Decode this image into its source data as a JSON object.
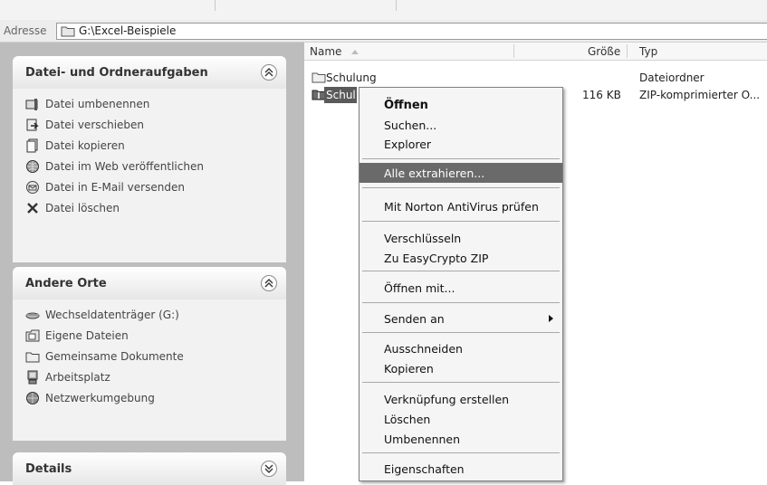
{
  "address": {
    "label": "Adresse",
    "path": "G:\\Excel-Beispiele"
  },
  "task_pane": {
    "panels": [
      {
        "title": "Datei- und Ordneraufgaben",
        "items": [
          {
            "label": "Datei umbenennen",
            "icon": "rename-icon"
          },
          {
            "label": "Datei verschieben",
            "icon": "move-icon"
          },
          {
            "label": "Datei kopieren",
            "icon": "copy-icon"
          },
          {
            "label": "Datei im Web veröffentlichen",
            "icon": "web-publish-icon"
          },
          {
            "label": "Datei in E-Mail versenden",
            "icon": "email-icon"
          },
          {
            "label": "Datei löschen",
            "icon": "delete-icon"
          }
        ]
      },
      {
        "title": "Andere Orte",
        "items": [
          {
            "label": "Wechseldatenträger (G:)",
            "icon": "removable-drive-icon"
          },
          {
            "label": "Eigene Dateien",
            "icon": "my-documents-icon"
          },
          {
            "label": "Gemeinsame Dokumente",
            "icon": "shared-folder-icon"
          },
          {
            "label": "Arbeitsplatz",
            "icon": "my-computer-icon"
          },
          {
            "label": "Netzwerkumgebung",
            "icon": "network-icon"
          }
        ]
      },
      {
        "title": "Details",
        "items": []
      }
    ]
  },
  "file_list": {
    "columns": {
      "name": "Name",
      "size": "Größe",
      "type": "Typ"
    },
    "rows": [
      {
        "name": "Schulung",
        "size": "",
        "type": "Dateiordner",
        "icon": "folder-icon"
      },
      {
        "name": "Schul",
        "size": "116 KB",
        "type": "ZIP-komprimierter O...",
        "icon": "zip-folder-icon"
      }
    ]
  },
  "context_menu": {
    "items": [
      {
        "label": "Öffnen",
        "bold": true
      },
      {
        "label": "Suchen..."
      },
      {
        "label": "Explorer"
      },
      {
        "label": "Alle extrahieren...",
        "highlighted": true
      },
      {
        "label": "Mit Norton AntiVirus prüfen"
      },
      {
        "label": "Verschlüsseln"
      },
      {
        "label": "Zu EasyCrypto ZIP"
      },
      {
        "label": "Öffnen mit..."
      },
      {
        "label": "Senden an",
        "submenu": true
      },
      {
        "label": "Ausschneiden"
      },
      {
        "label": "Kopieren"
      },
      {
        "label": "Verknüpfung erstellen"
      },
      {
        "label": "Löschen"
      },
      {
        "label": "Umbenennen"
      },
      {
        "label": "Eigenschaften"
      }
    ]
  },
  "colors": {
    "pane_background": "#bdbdbd",
    "highlight": "#6a6a6a",
    "selection": "#5a5a5a"
  }
}
